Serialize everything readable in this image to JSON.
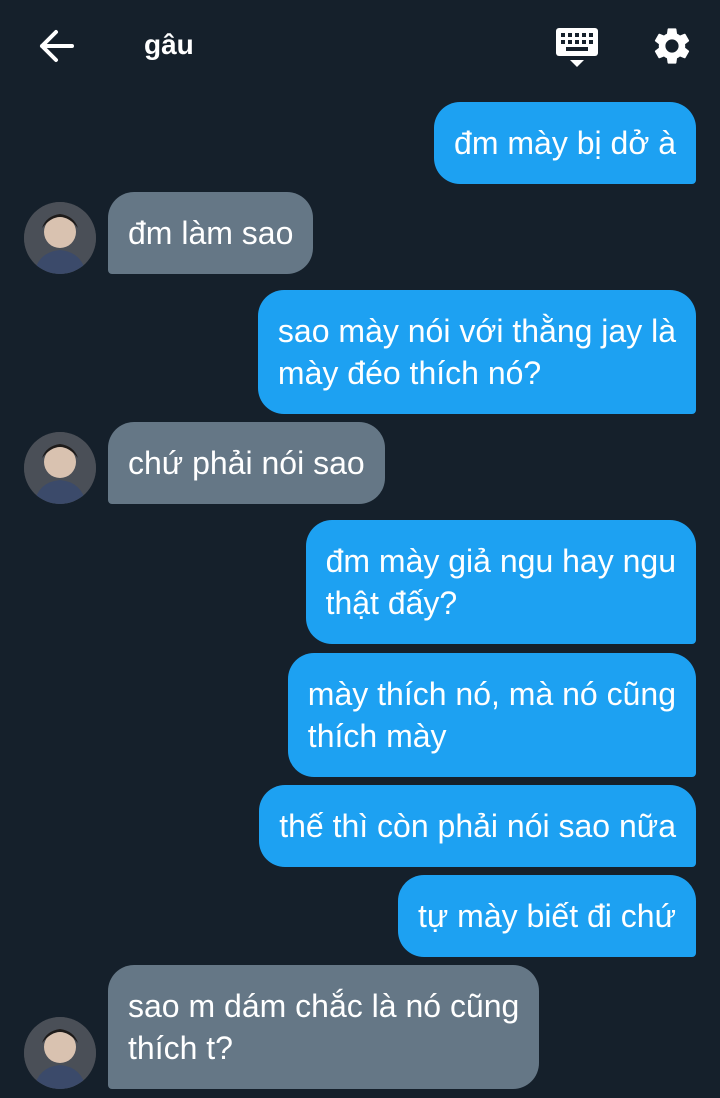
{
  "header": {
    "back_icon": "arrow-left-icon",
    "title": "gâu",
    "keyboard_icon": "keyboard-icon",
    "settings_icon": "gear-icon"
  },
  "colors": {
    "background": "#15202b",
    "outgoing_bubble": "#1da1f2",
    "incoming_bubble": "#657786",
    "text": "#ffffff"
  },
  "messages": [
    {
      "from": "me",
      "text_lines": [
        "đm mày bị dở à"
      ]
    },
    {
      "from": "them",
      "text_lines": [
        "đm làm sao"
      ]
    },
    {
      "from": "me",
      "text_lines": [
        "sao mày nói với thằng jay là",
        "mày đéo thích nó?"
      ]
    },
    {
      "from": "them",
      "text_lines": [
        "chứ phải nói sao"
      ]
    },
    {
      "from": "me",
      "text_lines": [
        "đm mày giả ngu hay ngu",
        "thật đấy?"
      ]
    },
    {
      "from": "me",
      "text_lines": [
        "mày thích nó, mà nó cũng",
        "thích mày"
      ]
    },
    {
      "from": "me",
      "text_lines": [
        "thế thì còn phải nói sao nữa"
      ]
    },
    {
      "from": "me",
      "text_lines": [
        "tự mày biết đi chứ"
      ]
    },
    {
      "from": "them",
      "text_lines": [
        "sao m dám chắc là nó cũng",
        "thích t?"
      ]
    }
  ]
}
